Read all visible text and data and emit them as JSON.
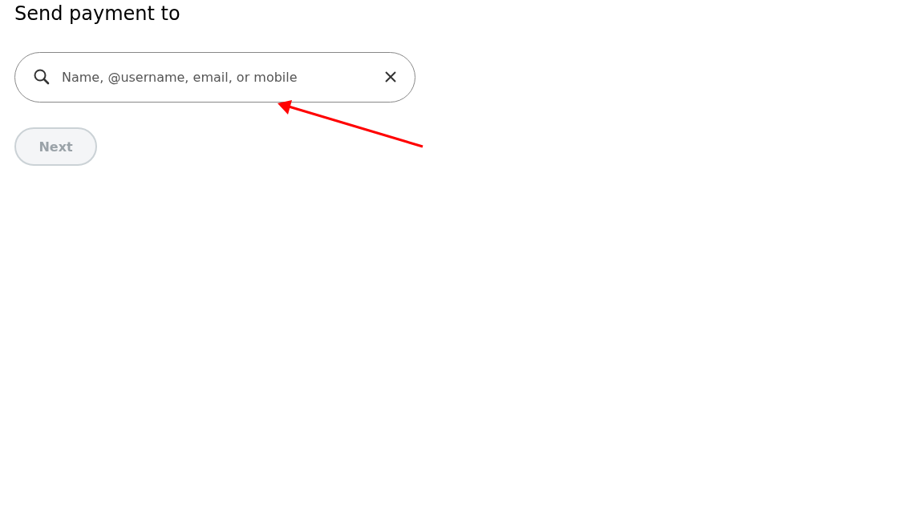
{
  "heading": "Send payment to",
  "search": {
    "placeholder": "Name, @username, email, or mobile"
  },
  "next_button": {
    "label": "Next",
    "disabled": true
  }
}
